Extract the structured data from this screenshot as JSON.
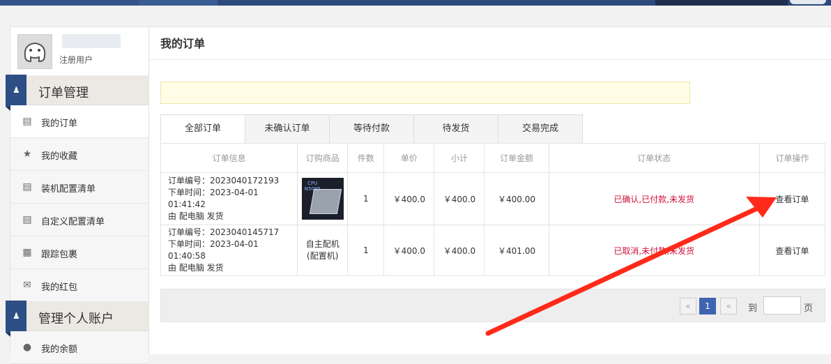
{
  "user": {
    "role": "注册用户"
  },
  "sidebar": {
    "groups": [
      {
        "title": "订单管理",
        "items": [
          {
            "label": "我的订单",
            "icon": "list-icon"
          },
          {
            "label": "我的收藏",
            "icon": "star-icon"
          },
          {
            "label": "装机配置清单",
            "icon": "list-icon"
          },
          {
            "label": "自定义配置清单",
            "icon": "list-icon"
          },
          {
            "label": "跟踪包裹",
            "icon": "grid-icon"
          },
          {
            "label": "我的红包",
            "icon": "envelope-icon"
          }
        ]
      },
      {
        "title": "管理个人账户",
        "items": [
          {
            "label": "我的余额",
            "icon": "money-bag-icon"
          }
        ]
      }
    ]
  },
  "main": {
    "title": "我的订单",
    "tabs": [
      "全部订单",
      "未确认订单",
      "等待付款",
      "待发货",
      "交易完成"
    ],
    "columns": [
      "订单信息",
      "订购商品",
      "件数",
      "单价",
      "小计",
      "订单金额",
      "订单状态",
      "订单操作"
    ],
    "orders": [
      {
        "order_no": "订单编号：2023040172193",
        "time": "下单时间：2023-04-01 01:41:42",
        "ship": "由 配电脑 发货",
        "product_img_text": "CPU\nN5095",
        "qty": "1",
        "price": "￥400.0",
        "subtotal": "￥400.0",
        "amount": "￥400.00",
        "status": "已确认,已付款,未发货",
        "action": "查看订单"
      },
      {
        "order_no": "订单编号：2023040145717",
        "time": "下单时间：2023-04-01 01:40:58",
        "ship": "由 配电脑 发货",
        "product": "自主配机(配置机)",
        "qty": "1",
        "price": "￥400.0",
        "subtotal": "￥400.0",
        "amount": "￥401.00",
        "status": "已取消,未付款,未发货",
        "action": "查看订单"
      }
    ],
    "pager": {
      "prev": "«",
      "current": "1",
      "next": "«",
      "goto_label": "到",
      "page_suffix": "页"
    }
  },
  "colors": {
    "accent": "#2d4f86",
    "status_red": "#d0103a",
    "page_active": "#3d64b0",
    "arrow": "#ff2a1a"
  }
}
